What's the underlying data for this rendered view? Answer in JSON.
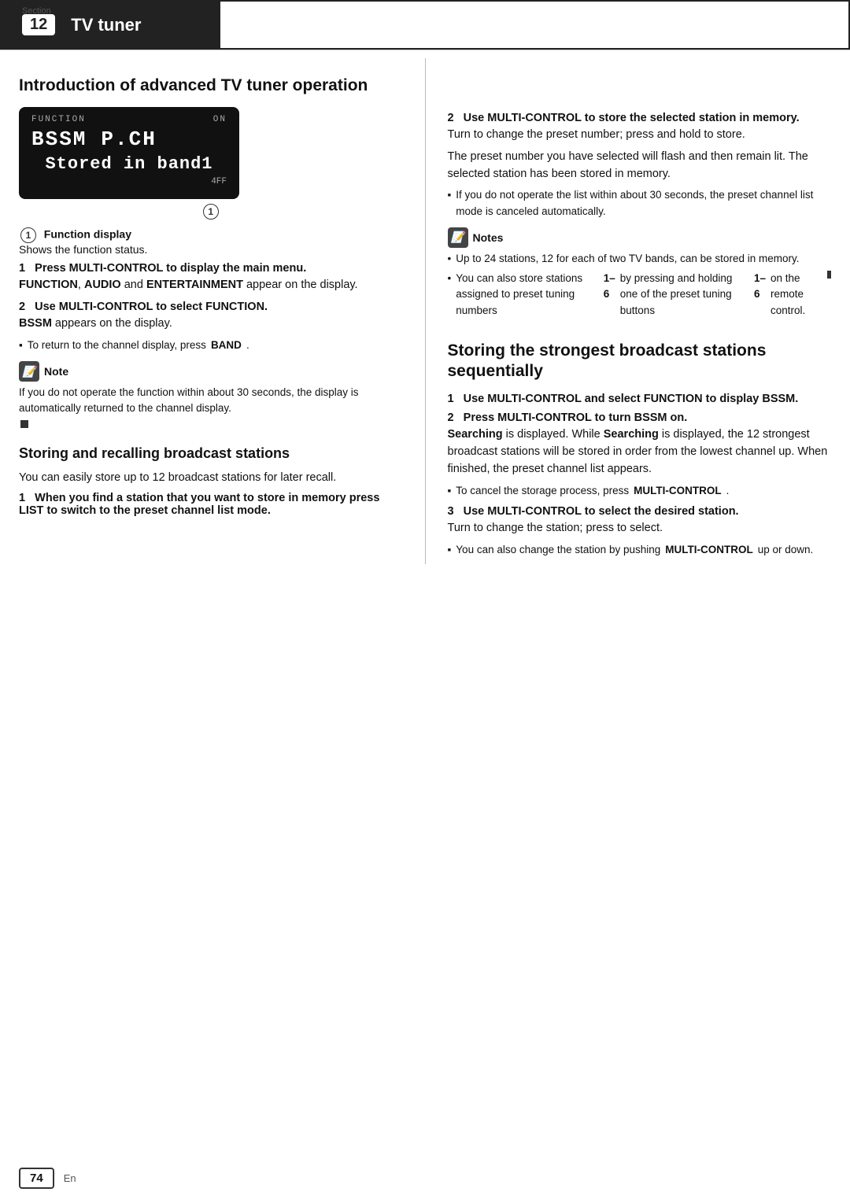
{
  "header": {
    "section_label": "Section",
    "section_num": "12",
    "title": "TV tuner"
  },
  "intro_section": {
    "heading": "Introduction of advanced TV tuner operation",
    "display": {
      "top_bar": "FUNCTION",
      "on_label": "ON",
      "main_left": "BSSM",
      "main_right": "P.CH",
      "stored_text": "Stored in band1",
      "off_label": "4FF"
    },
    "circle_label": "1",
    "func_display_heading": "Function display",
    "func_display_sub": "Shows the function status.",
    "step1_title": "1   Press MULTI-CONTROL to display the main menu.",
    "step1_body": "FUNCTION, AUDIO and ENTERTAINMENT appear on the display.",
    "step2_title": "2   Use MULTI-CONTROL to select FUNCTION.",
    "step2_body": "BSSM appears on the display.",
    "step2_bullet": "To return to the channel display, press BAND.",
    "note_header": "Note",
    "note_body": "If you do not operate the function within about 30 seconds, the display is automatically returned to the channel display."
  },
  "storing_recalling_section": {
    "heading": "Storing and recalling broadcast stations",
    "intro": "You can easily store up to 12 broadcast stations for later recall.",
    "step1_title": "1   When you find a station that you want to store in memory press LIST to switch to the preset channel list mode."
  },
  "right_col": {
    "step2_title": "2   Use MULTI-CONTROL to store the selected station in memory.",
    "step2_body1": "Turn to change the preset number; press and hold to store.",
    "step2_body2": "The preset number you have selected will flash and then remain lit. The selected station has been stored in memory.",
    "step2_bullet": "If you do not operate the list within about 30 seconds, the preset channel list mode is canceled automatically.",
    "notes_header": "Notes",
    "notes_bullets": [
      "Up to 24 stations, 12 for each of two TV bands, can be stored in memory.",
      "You can also store stations assigned to preset tuning numbers 1–6 by pressing and holding one of the preset tuning buttons 1–6 on the remote control."
    ]
  },
  "strongest_section": {
    "heading": "Storing the strongest broadcast stations sequentially",
    "step1_title": "1   Use MULTI-CONTROL and select FUNCTION to display BSSM.",
    "step2_title": "2   Press MULTI-CONTROL to turn BSSM on.",
    "step2_body1": "Searching is displayed. While Searching is displayed, the 12 strongest broadcast stations will be stored in order from the lowest channel up. When finished, the preset channel list appears.",
    "step2_bullet": "To cancel the storage process, press MULTI-CONTROL.",
    "step3_title": "3   Use MULTI-CONTROL to select the desired station.",
    "step3_body": "Turn to change the station; press to select.",
    "step3_bullet": "You can also change the station by pushing MULTI-CONTROL up or down."
  },
  "footer": {
    "page_num": "74",
    "lang": "En"
  }
}
